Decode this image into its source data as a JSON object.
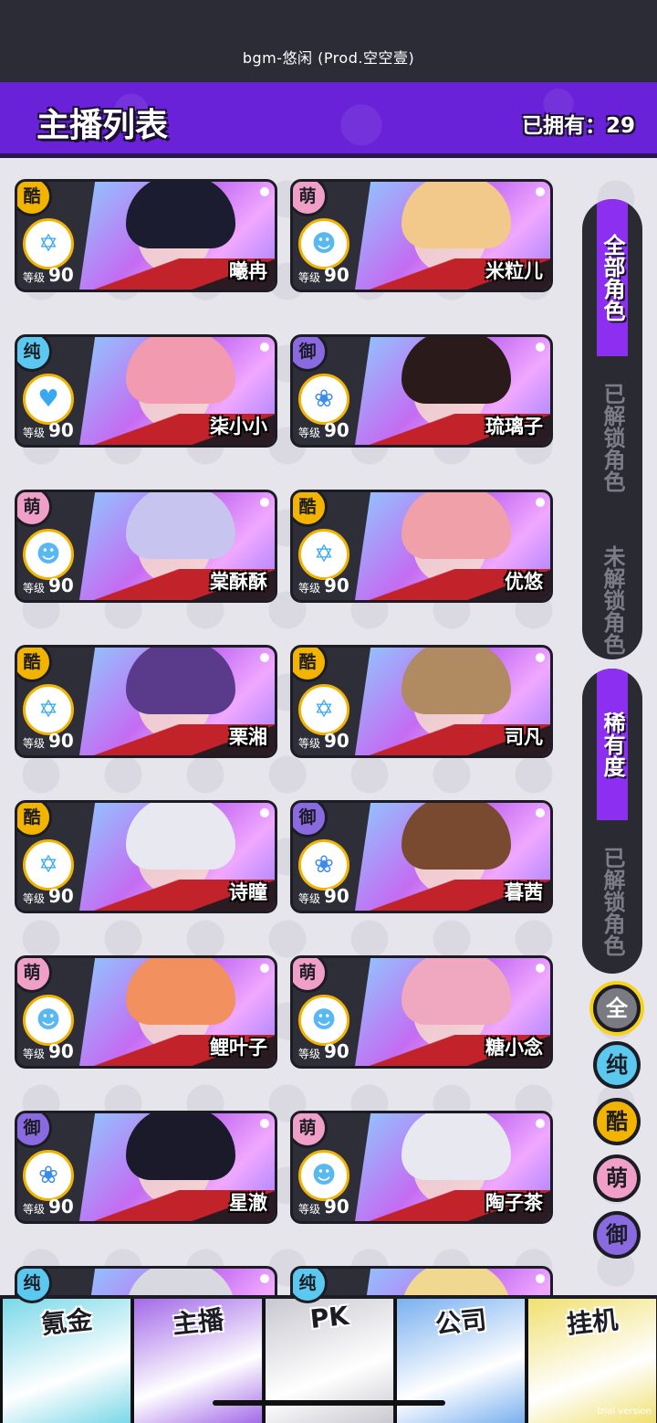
{
  "status_bar": {
    "bgm_text": "bgm-悠闲 (Prod.空空壹)"
  },
  "header": {
    "title": "主播列表",
    "owned_label": "已拥有：29"
  },
  "colors": {
    "header_purple": "#6a22d8",
    "active_tab": "#8c2ff0",
    "rarity_cool": "#f2b400",
    "rarity_cute": "#f0a0c8",
    "rarity_pure": "#5bc8f0",
    "rarity_royal": "#8a6ae0"
  },
  "streamers": [
    {
      "badge": "酷",
      "level_label": "等级",
      "level": "90",
      "name": "曦冉",
      "hair": "#1c1c30",
      "icon": "star-icon"
    },
    {
      "badge": "萌",
      "level_label": "等级",
      "level": "90",
      "name": "米粒儿",
      "hair": "#f2c98a",
      "icon": "cat-icon"
    },
    {
      "badge": "纯",
      "level_label": "等级",
      "level": "90",
      "name": "柒小小",
      "hair": "#f29ab0",
      "icon": "heartbeat-icon"
    },
    {
      "badge": "御",
      "level_label": "等级",
      "level": "90",
      "name": "琉璃子",
      "hair": "#2a1a1a",
      "icon": "rose-icon"
    },
    {
      "badge": "萌",
      "level_label": "等级",
      "level": "90",
      "name": "棠酥酥",
      "hair": "#c8c4f0",
      "icon": "cat-icon"
    },
    {
      "badge": "酷",
      "level_label": "等级",
      "level": "90",
      "name": "优悠",
      "hair": "#f0a0a8",
      "icon": "star-icon"
    },
    {
      "badge": "酷",
      "level_label": "等级",
      "level": "90",
      "name": "栗湘",
      "hair": "#5a3a8a",
      "icon": "star-icon"
    },
    {
      "badge": "酷",
      "level_label": "等级",
      "level": "90",
      "name": "司凡",
      "hair": "#b08a60",
      "icon": "star-icon"
    },
    {
      "badge": "酷",
      "level_label": "等级",
      "level": "90",
      "name": "诗瞳",
      "hair": "#e8e8f0",
      "icon": "star-icon"
    },
    {
      "badge": "御",
      "level_label": "等级",
      "level": "90",
      "name": "暮茜",
      "hair": "#7a4a30",
      "icon": "rose-icon"
    },
    {
      "badge": "萌",
      "level_label": "等级",
      "level": "90",
      "name": "鲤叶子",
      "hair": "#f29060",
      "icon": "cat-icon"
    },
    {
      "badge": "萌",
      "level_label": "等级",
      "level": "90",
      "name": "糖小念",
      "hair": "#f0a8c0",
      "icon": "cat-icon"
    },
    {
      "badge": "御",
      "level_label": "等级",
      "level": "90",
      "name": "星澈",
      "hair": "#1a1a2a",
      "icon": "rose-icon"
    },
    {
      "badge": "萌",
      "level_label": "等级",
      "level": "90",
      "name": "陶子茶",
      "hair": "#e8e8f0",
      "icon": "cat-icon"
    },
    {
      "badge": "纯",
      "level_label": "",
      "level": "",
      "name": "",
      "hair": "#d8d8e0",
      "icon": ""
    },
    {
      "badge": "纯",
      "level_label": "",
      "level": "",
      "name": "",
      "hair": "#f0d890",
      "icon": ""
    }
  ],
  "side_tabs": {
    "all": "全部角色",
    "unlocked": "已解锁角色",
    "locked": "未解锁角色"
  },
  "rarity_tabs": {
    "rarity": "稀有度",
    "unlocked": "已解锁角色"
  },
  "filters": [
    {
      "label": "全",
      "color": "#7a7a82"
    },
    {
      "label": "纯",
      "color": "#5bc8f0"
    },
    {
      "label": "酷",
      "color": "#f2b400"
    },
    {
      "label": "萌",
      "color": "#f0a0c8"
    },
    {
      "label": "御",
      "color": "#8a6ae0"
    }
  ],
  "bottom_nav": [
    {
      "label": "氪金",
      "color": "#7ad8e8"
    },
    {
      "label": "主播",
      "color": "#a36ae8"
    },
    {
      "label": "PK",
      "color": "#c8c8d0"
    },
    {
      "label": "公司",
      "color": "#7ab0f0"
    },
    {
      "label": "挂机",
      "color": "#f0e070"
    }
  ],
  "watermark": "trial version"
}
